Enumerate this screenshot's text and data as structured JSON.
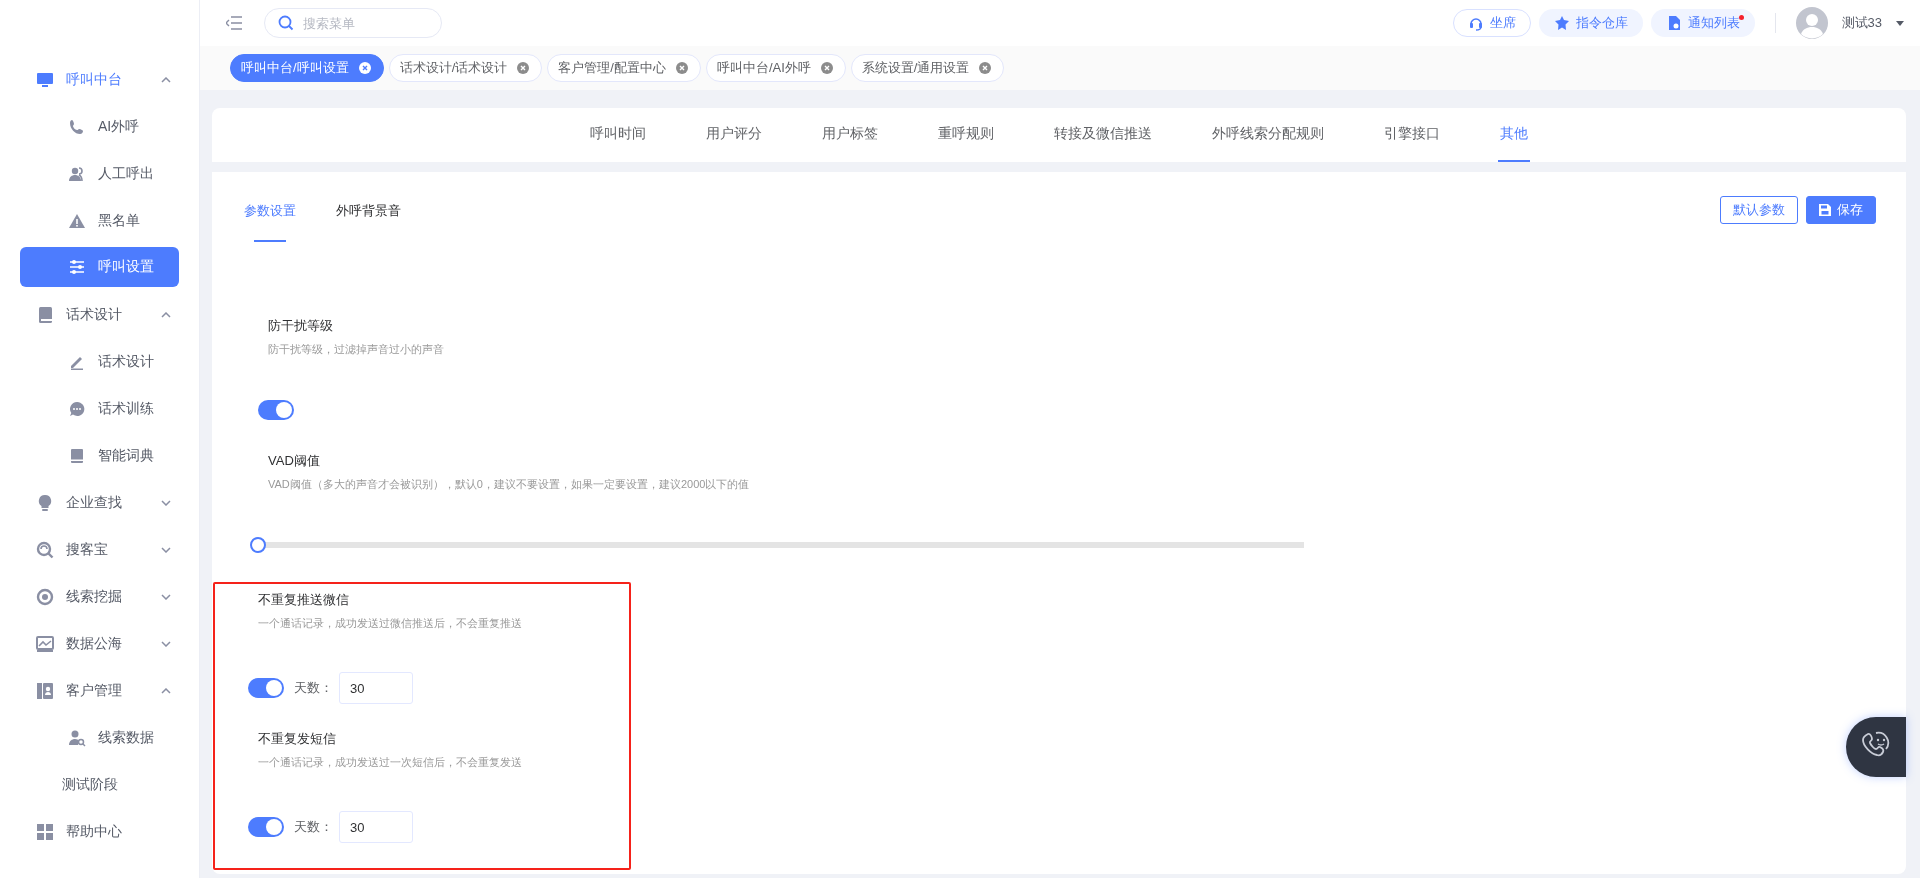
{
  "sidebar": {
    "items": [
      {
        "label": "呼叫中台",
        "active": true,
        "expanded": true,
        "children": [
          {
            "label": "AI外呼",
            "selected": false
          },
          {
            "label": "人工呼出",
            "selected": false
          },
          {
            "label": "黑名单",
            "selected": false
          },
          {
            "label": "呼叫设置",
            "selected": true
          }
        ]
      },
      {
        "label": "话术设计",
        "active": false,
        "expanded": true,
        "children": [
          {
            "label": "话术设计",
            "selected": false
          },
          {
            "label": "话术训练",
            "selected": false
          },
          {
            "label": "智能词典",
            "selected": false
          }
        ]
      },
      {
        "label": "企业查找",
        "active": false,
        "expanded": false
      },
      {
        "label": "搜客宝",
        "active": false,
        "expanded": false
      },
      {
        "label": "线索挖掘",
        "active": false,
        "expanded": false
      },
      {
        "label": "数据公海",
        "active": false,
        "expanded": false
      },
      {
        "label": "客户管理",
        "active": false,
        "expanded": true,
        "children": [
          {
            "label": "线索数据",
            "selected": false
          },
          {
            "label": "测试阶段",
            "selected": false
          }
        ]
      },
      {
        "label": "帮助中心",
        "active": false
      }
    ]
  },
  "header": {
    "search": {
      "placeholder": "搜索菜单"
    },
    "buttons": [
      {
        "label": "坐席",
        "kind": "outline",
        "unread": false
      },
      {
        "label": "指令仓库",
        "kind": "soft",
        "unread": false
      },
      {
        "label": "通知列表",
        "kind": "soft",
        "unread": true
      }
    ],
    "user": {
      "name": "测试33"
    }
  },
  "tags": [
    {
      "label": "呼叫中台/呼叫设置",
      "selected": true
    },
    {
      "label": "话术设计/话术设计",
      "selected": false
    },
    {
      "label": "客户管理/配置中心",
      "selected": false
    },
    {
      "label": "呼叫中台/AI外呼",
      "selected": false
    },
    {
      "label": "系统设置/通用设置",
      "selected": false
    }
  ],
  "tabs": [
    {
      "label": "呼叫时间",
      "selected": false
    },
    {
      "label": "用户评分",
      "selected": false
    },
    {
      "label": "用户标签",
      "selected": false
    },
    {
      "label": "重呼规则",
      "selected": false
    },
    {
      "label": "转接及微信推送",
      "selected": false
    },
    {
      "label": "外呼线索分配规则",
      "selected": false
    },
    {
      "label": "引擎接口",
      "selected": false
    },
    {
      "label": "其他",
      "selected": true
    }
  ],
  "subtabs": [
    {
      "label": "参数设置",
      "selected": true
    },
    {
      "label": "外呼背景音",
      "selected": false
    }
  ],
  "actions": [
    {
      "label": "默认参数",
      "kind": "outline"
    },
    {
      "label": "保存",
      "kind": "primary"
    }
  ],
  "settings": [
    {
      "kind": "switch",
      "title": "防干扰等级",
      "description": "防干扰等级，过滤掉声音过小的声音",
      "on": true,
      "highlighted": false
    },
    {
      "kind": "slider",
      "title": "VAD阈值",
      "description": "VAD阈值（多大的声音才会被识别），默认0，建议不要设置，如果一定要设置，建议2000以下的值",
      "level": 0,
      "highlighted": false
    },
    {
      "kind": "switch-days",
      "title": "不重复推送微信",
      "description": "一个通话记录，成功发送过微信推送后，不会重复推送",
      "on": true,
      "days_label": "天数：",
      "days": "30",
      "highlighted": true
    },
    {
      "kind": "switch-days",
      "title": "不重复发短信",
      "description": "一个通话记录，成功发送过一次短信后，不会重复发送",
      "on": true,
      "days_label": "天数：",
      "days": "30",
      "highlighted": true
    }
  ]
}
